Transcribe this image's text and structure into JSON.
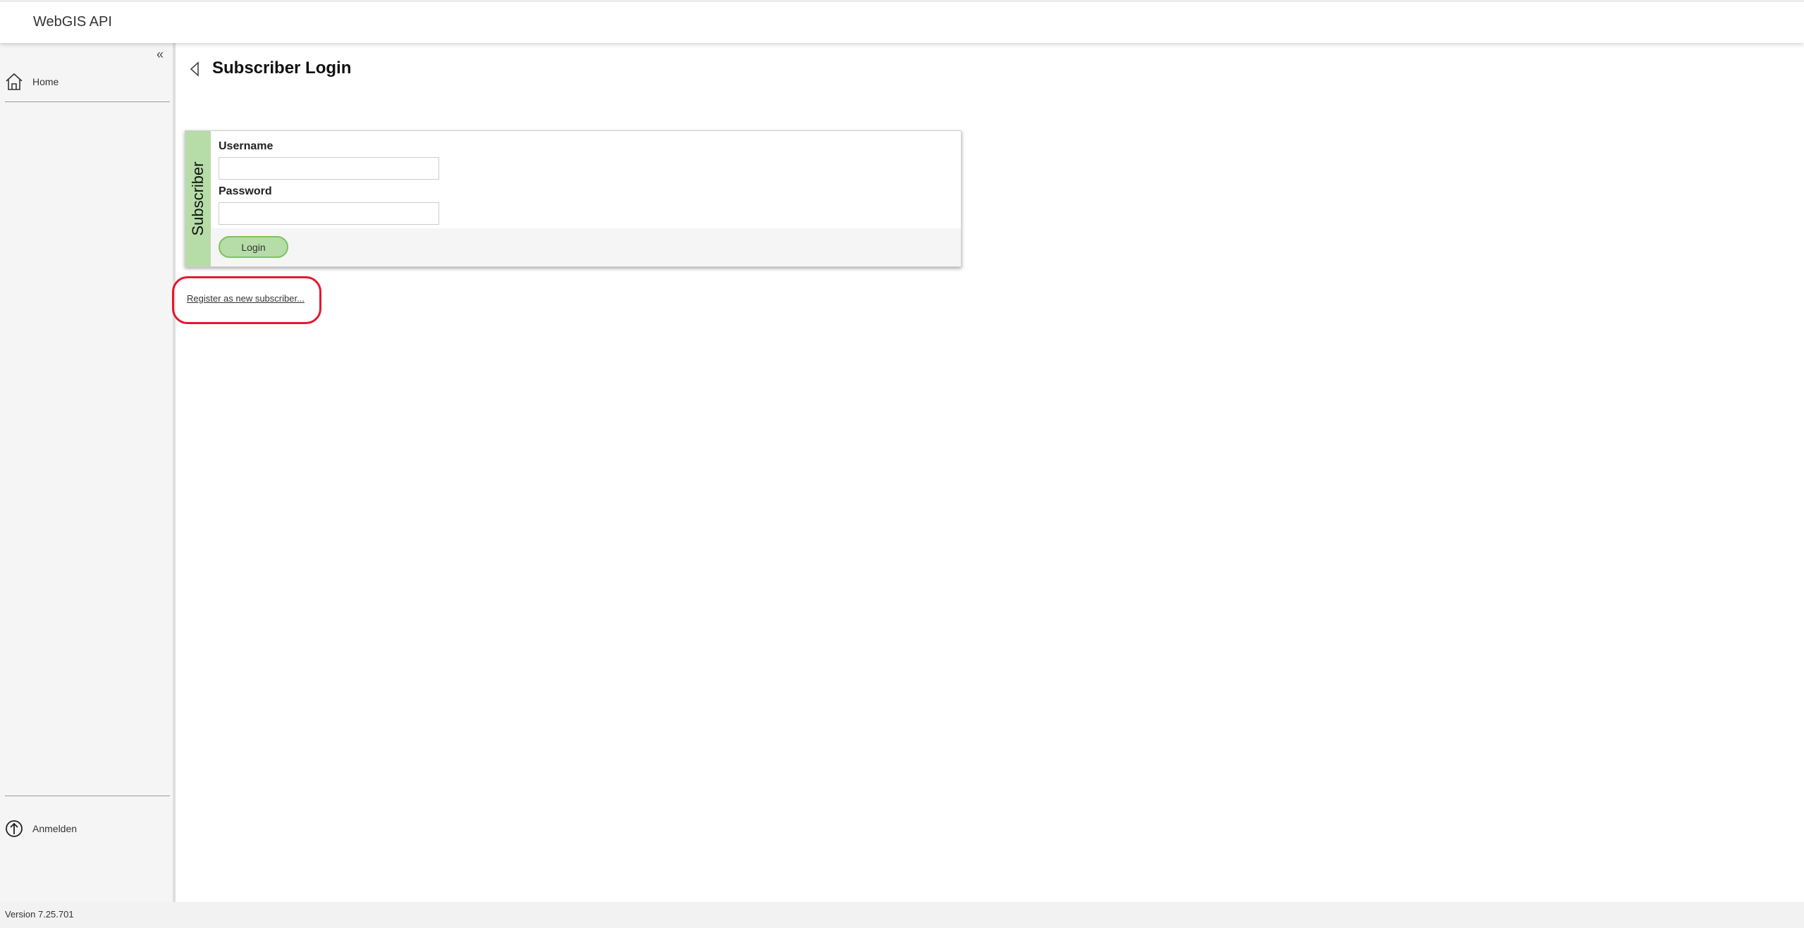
{
  "header": {
    "title": "WebGIS API"
  },
  "sidebar": {
    "collapse_label": "«",
    "items": [
      {
        "label": "Home",
        "icon": "home-icon"
      },
      {
        "label": "Anmelden",
        "icon": "login-arrow-icon"
      }
    ]
  },
  "page": {
    "title": "Subscriber Login"
  },
  "login_form": {
    "tab_label": "Subscriber",
    "username_label": "Username",
    "username_value": "",
    "password_label": "Password",
    "password_value": "",
    "login_button": "Login"
  },
  "register_link": "Register as new subscriber...",
  "footer": {
    "version": "Version 7.25.701"
  },
  "colors": {
    "accent_green": "#b6dca8",
    "button_border": "#7fc25d",
    "highlight_red": "#e3182d"
  }
}
